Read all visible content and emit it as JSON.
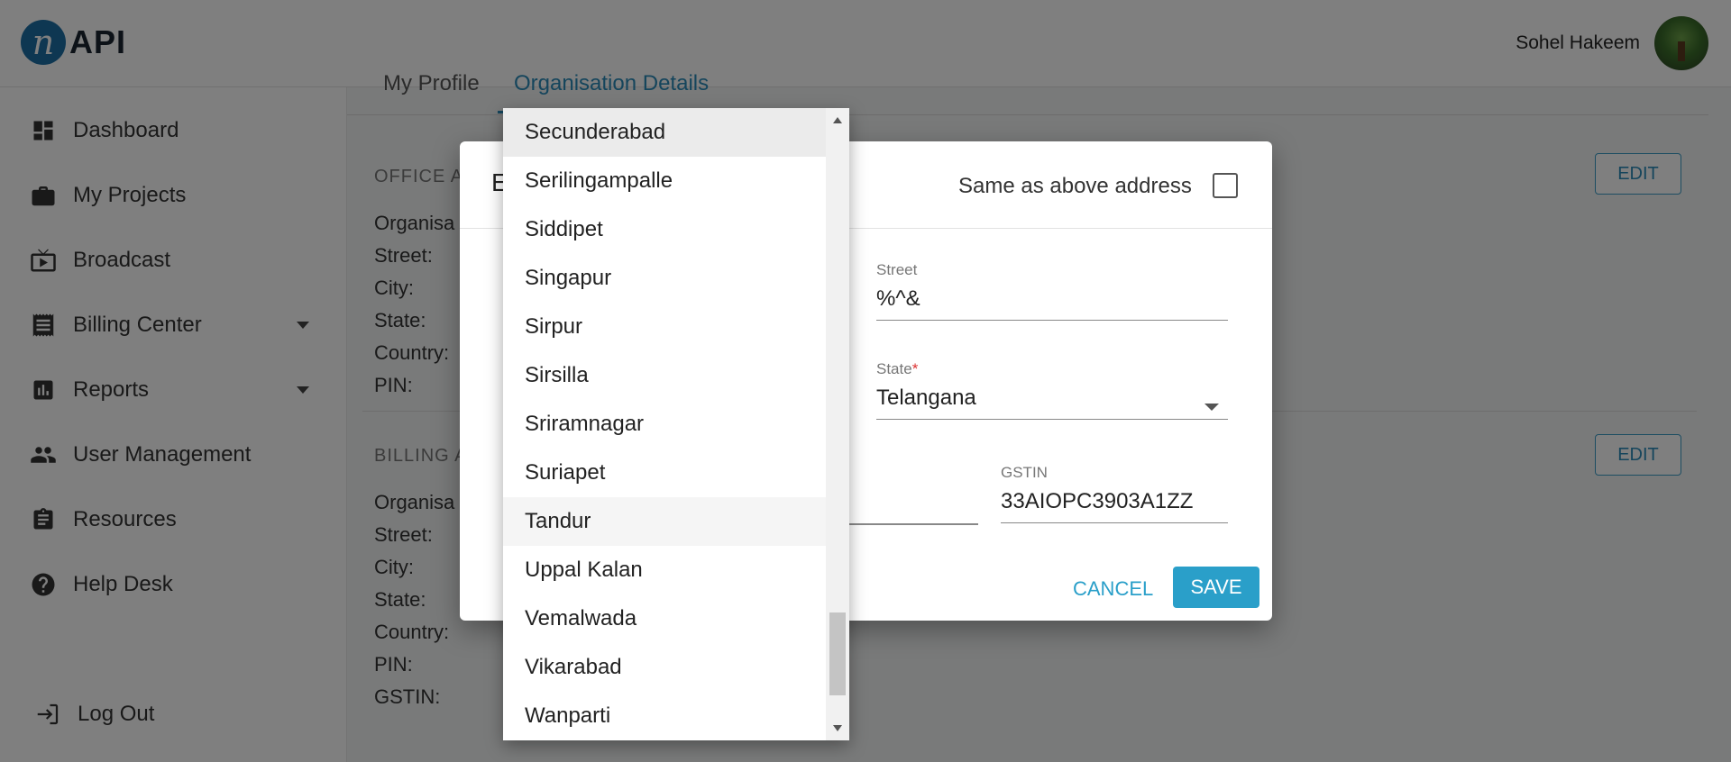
{
  "app": {
    "logo_letter": "n",
    "logo_text": "API"
  },
  "user": {
    "name": "Sohel Hakeem"
  },
  "sidebar": {
    "items": [
      {
        "label": "Dashboard",
        "icon": "dashboard-icon",
        "has_caret": false
      },
      {
        "label": "My Projects",
        "icon": "briefcase-icon",
        "has_caret": false
      },
      {
        "label": "Broadcast",
        "icon": "broadcast-tv-icon",
        "has_caret": false
      },
      {
        "label": "Billing Center",
        "icon": "receipt-icon",
        "has_caret": true
      },
      {
        "label": "Reports",
        "icon": "bar-chart-icon",
        "has_caret": true
      },
      {
        "label": "User Management",
        "icon": "people-icon",
        "has_caret": false
      },
      {
        "label": "Resources",
        "icon": "clipboard-icon",
        "has_caret": false
      },
      {
        "label": "Help Desk",
        "icon": "help-circle-icon",
        "has_caret": false
      }
    ],
    "logout_label": "Log Out"
  },
  "main": {
    "tabs": [
      "My Profile",
      "Organisation Details"
    ],
    "office_section": {
      "title": "OFFICE AD",
      "fields": [
        "Organisa",
        "Street:",
        "City:",
        "State:",
        "Country:",
        "PIN:"
      ],
      "edit_label": "EDIT"
    },
    "billing_section": {
      "title": "BILLING A",
      "fields": [
        "Organisa",
        "Street:",
        "City:",
        "State:",
        "Country:",
        "PIN:",
        "GSTIN:"
      ],
      "edit_label": "EDIT"
    }
  },
  "dialog": {
    "title": "E",
    "same_as_above_label": "Same as above address",
    "same_as_above_checked": false,
    "street": {
      "label": "Street",
      "value": "%^&"
    },
    "state": {
      "label": "State",
      "required_mark": "*",
      "value": "Telangana"
    },
    "gstin": {
      "label": "GSTIN",
      "value": "33AIOPC3903A1ZZ"
    },
    "cancel_label": "CANCEL",
    "save_label": "SAVE"
  },
  "dropdown": {
    "options": [
      "Secunderabad",
      "Serilingampalle",
      "Siddipet",
      "Singapur",
      "Sirpur",
      "Sirsilla",
      "Sriramnagar",
      "Suriapet",
      "Tandur",
      "Uppal Kalan",
      "Vemalwada",
      "Vikarabad",
      "Wanparti"
    ],
    "selected": "Secunderabad",
    "hovered": "Tandur"
  },
  "colors": {
    "accent": "#2a9fc9",
    "overlay": "rgba(0,0,0,0.5)",
    "logo_badge": "#1d6fa5"
  }
}
